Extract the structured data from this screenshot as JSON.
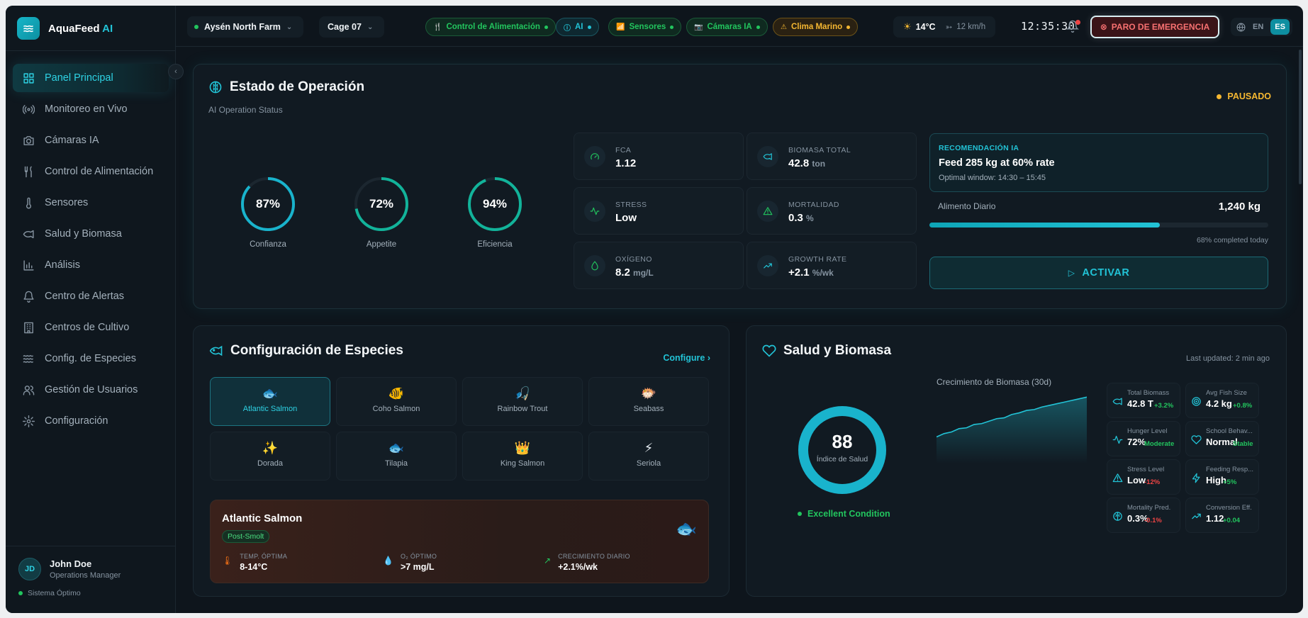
{
  "app": {
    "name": "AquaFeed",
    "name_ai": "AI"
  },
  "sidebar": {
    "items": [
      {
        "label": "Panel Principal",
        "icon": "dashboard-icon"
      },
      {
        "label": "Monitoreo en Vivo",
        "icon": "broadcast-icon"
      },
      {
        "label": "Cámaras IA",
        "icon": "camera-icon"
      },
      {
        "label": "Control de Alimentación",
        "icon": "utensils-icon"
      },
      {
        "label": "Sensores",
        "icon": "thermometer-icon"
      },
      {
        "label": "Salud y Biomasa",
        "icon": "fish-icon"
      },
      {
        "label": "Análisis",
        "icon": "bar-chart-icon"
      },
      {
        "label": "Centro de Alertas",
        "icon": "bell-icon"
      },
      {
        "label": "Centros de Cultivo",
        "icon": "building-icon"
      },
      {
        "label": "Config. de Especies",
        "icon": "waves-icon"
      },
      {
        "label": "Gestión de Usuarios",
        "icon": "users-icon"
      },
      {
        "label": "Configuración",
        "icon": "gear-icon"
      }
    ],
    "active_index": 0
  },
  "user": {
    "initials": "JD",
    "name": "John Doe",
    "role": "Operations Manager",
    "status": "Sistema Óptimo"
  },
  "topbar": {
    "farm": "Aysén North Farm",
    "cage": "Cage 07",
    "pills": [
      {
        "label": "Control de Alimentación",
        "tone": "green"
      },
      {
        "label": "AI",
        "tone": "cyan"
      },
      {
        "label": "Sensores",
        "tone": "green"
      },
      {
        "label": "Cámaras IA",
        "tone": "green"
      },
      {
        "label": "Clima Marino",
        "tone": "yellow"
      }
    ],
    "temperature": "14°C",
    "wind": "12 km/h",
    "time": "12:35:30",
    "emergency": "PARO DE EMERGENCIA",
    "languages": [
      "EN",
      "ES"
    ],
    "active_language": "ES"
  },
  "operation": {
    "title": "Estado de Operación",
    "subtitle": "AI Operation Status",
    "status": "PAUSADO",
    "gauges": [
      {
        "value": "87%",
        "percent": 87,
        "label": "Confianza"
      },
      {
        "value": "72%",
        "percent": 72,
        "label": "Appetite"
      },
      {
        "value": "94%",
        "percent": 94,
        "label": "Eficiencia"
      }
    ],
    "metrics": [
      {
        "label": "FCA",
        "value": "1.12",
        "unit": ""
      },
      {
        "label": "BIOMASA TOTAL",
        "value": "42.8",
        "unit": "ton"
      },
      {
        "label": "STRESS",
        "value": "Low",
        "unit": ""
      },
      {
        "label": "MORTALIDAD",
        "value": "0.3",
        "unit": "%"
      },
      {
        "label": "OXÍGENO",
        "value": "8.2",
        "unit": "mg/L"
      },
      {
        "label": "GROWTH RATE",
        "value": "+2.1",
        "unit": "%/wk"
      }
    ],
    "recommendation": {
      "title": "RECOMENDACIÓN IA",
      "message": "Feed 285 kg at 60% rate",
      "window": "Optimal window: 14:30 – 15:45"
    },
    "daily_feed": {
      "label": "Alimento Diario",
      "value": "1,240 kg",
      "progress": 68,
      "progress_text": "68% completed today"
    },
    "activate": "ACTIVAR"
  },
  "species": {
    "title": "Configuración de Especies",
    "configure": "Configure",
    "items": [
      {
        "name": "Atlantic Salmon",
        "emoji": "🐟"
      },
      {
        "name": "Coho Salmon",
        "emoji": "🐠"
      },
      {
        "name": "Rainbow Trout",
        "emoji": "🎣"
      },
      {
        "name": "Seabass",
        "emoji": "🐡"
      },
      {
        "name": "Dorada",
        "emoji": "✨"
      },
      {
        "name": "Tilapia",
        "emoji": "🐟"
      },
      {
        "name": "King Salmon",
        "emoji": "👑"
      },
      {
        "name": "Seriola",
        "emoji": "⚡"
      }
    ],
    "selected_index": 0,
    "detail": {
      "name": "Atlantic Salmon",
      "stage": "Post-Smolt",
      "emoji": "🐟",
      "stats": [
        {
          "label": "TEMP. ÓPTIMA",
          "value": "8-14°C"
        },
        {
          "label": "O₂ ÓPTIMO",
          "value": ">7 mg/L"
        },
        {
          "label": "CRECIMIENTO DIARIO",
          "value": "+2.1%/wk"
        }
      ]
    }
  },
  "health": {
    "title": "Salud y Biomasa",
    "updated": "Last updated: 2 min ago",
    "index_value": "88",
    "index_percent": 88,
    "index_label": "Índice de Salud",
    "condition": "Excellent Condition",
    "chart_title": "Crecimiento de Biomasa (30d)",
    "stats": [
      {
        "label": "Total Biomass",
        "value": "42.8 T",
        "change": "+3.2%",
        "neg": false,
        "icon": "fish-icon"
      },
      {
        "label": "Avg Fish Size",
        "value": "4.2 kg",
        "change": "+0.8%",
        "neg": false,
        "icon": "target-icon"
      },
      {
        "label": "Hunger Level",
        "value": "72%",
        "change": "Moderate",
        "neg": false,
        "icon": "activity-icon"
      },
      {
        "label": "School Behav...",
        "value": "Normal",
        "change": "Stable",
        "neg": false,
        "icon": "heart-icon"
      },
      {
        "label": "Stress Level",
        "value": "Low",
        "change": "-12%",
        "neg": true,
        "icon": "warning-icon"
      },
      {
        "label": "Feeding Resp...",
        "value": "High",
        "change": "+5%",
        "neg": false,
        "icon": "bolt-icon"
      },
      {
        "label": "Mortality Pred.",
        "value": "0.3%",
        "change": "-0.1%",
        "neg": true,
        "icon": "brain-icon"
      },
      {
        "label": "Conversion Eff.",
        "value": "1.12",
        "change": "+0.04",
        "neg": false,
        "icon": "trend-up-icon"
      }
    ]
  },
  "chart_data": {
    "type": "area",
    "title": "Crecimiento de Biomasa (30d)",
    "values": [
      38.0,
      38.4,
      38.6,
      39.0,
      39.1,
      39.5,
      39.6,
      39.9,
      40.2,
      40.3,
      40.7,
      40.9,
      41.2,
      41.3,
      41.6,
      41.8,
      42.0,
      42.2,
      42.4,
      42.6,
      42.8
    ],
    "colors": {
      "line": "#22c3d6"
    }
  },
  "colors": {
    "accent": "#22c3d6",
    "good": "#22c55e",
    "warn": "#f5b731",
    "danger": "#ef4444"
  }
}
